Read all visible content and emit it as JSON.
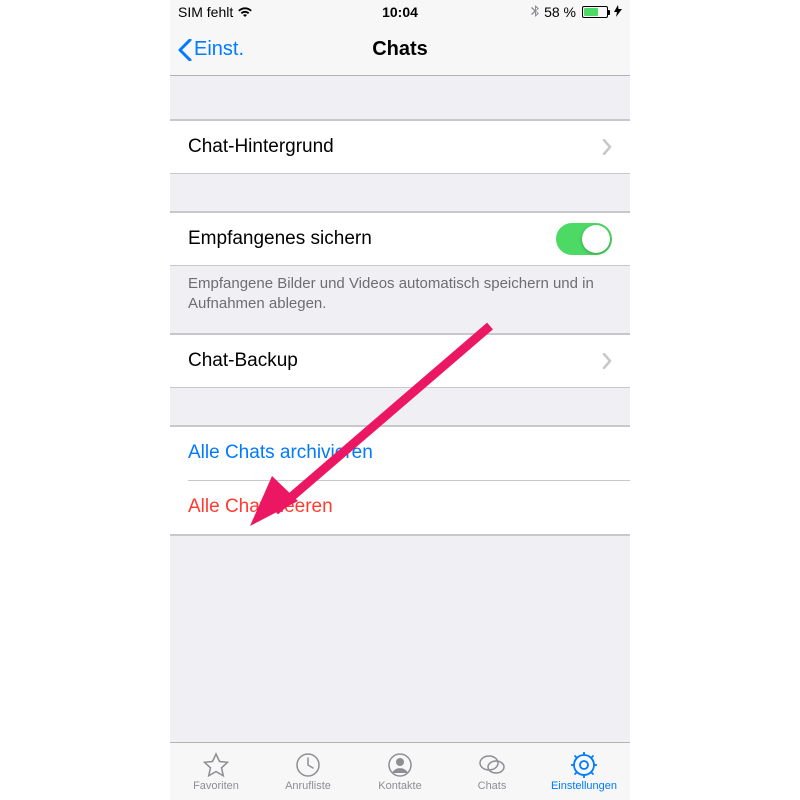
{
  "status": {
    "carrier": "SIM fehlt",
    "time": "10:04",
    "battery_pct": "58 %"
  },
  "nav": {
    "back_label": "Einst.",
    "title": "Chats"
  },
  "rows": {
    "wallpaper": "Chat-Hintergrund",
    "save_incoming": "Empfangenes sichern",
    "save_incoming_footer": "Empfangene Bilder und Videos automatisch speichern und in Aufnahmen ablegen.",
    "backup": "Chat-Backup",
    "archive_all": "Alle Chats archivieren",
    "clear_all": "Alle Chats leeren"
  },
  "tabs": {
    "favorites": "Favoriten",
    "calls": "Anrufliste",
    "contacts": "Kontakte",
    "chats": "Chats",
    "settings": "Einstellungen"
  }
}
